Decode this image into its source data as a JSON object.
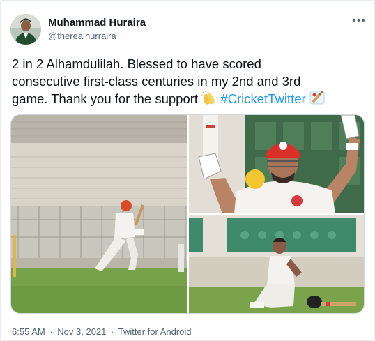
{
  "author": {
    "name": "Muhammad Huraira",
    "handle": "@therealhurraira"
  },
  "icons": {
    "more": "more-options-icon",
    "clap": "clapping-hands-emoji",
    "cricket": "cricket-emoji"
  },
  "tweet": {
    "line1": "2 in 2 Alhamdulilah. Blessed to have scored",
    "line2": "consecutive first-class centuries in my 2nd and 3rd",
    "line3_text": "game. Thank you for the support",
    "hashtag": "#CricketTwitter"
  },
  "meta": {
    "time": "6:55 AM",
    "separator1": "·",
    "date": "Nov 3, 2021",
    "separator2": "·",
    "source": "Twitter for Android"
  },
  "colors": {
    "link": "#1d9bf0",
    "text": "#0f1419",
    "secondary": "#536471"
  }
}
